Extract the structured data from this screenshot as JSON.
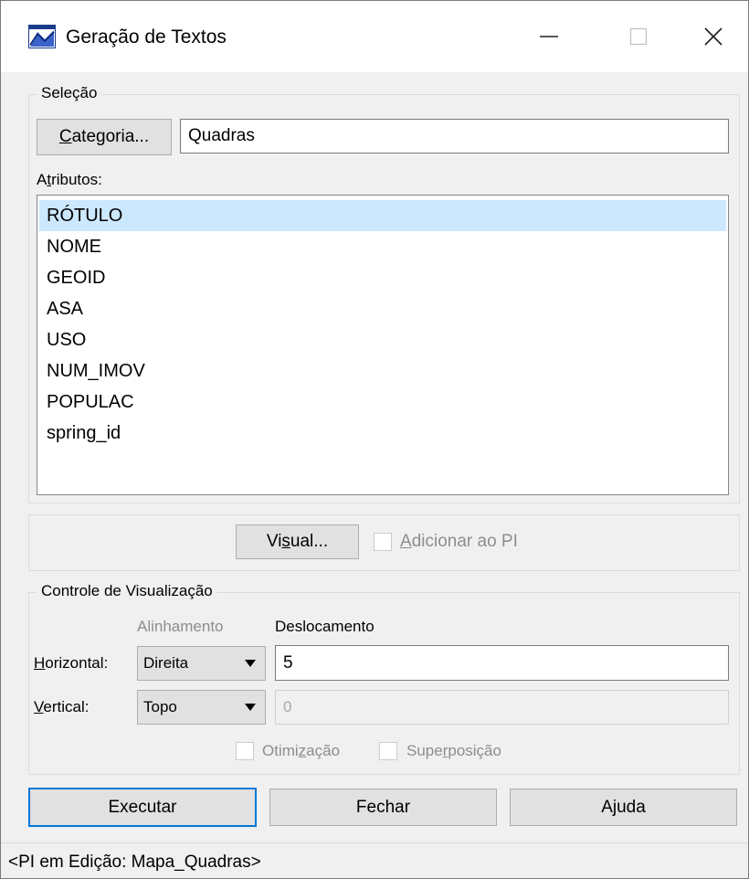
{
  "window": {
    "title": "Geração de Textos"
  },
  "selecao": {
    "legend": "Seleção",
    "categoria_button": {
      "pre": "",
      "access": "C",
      "post": "ategoria..."
    },
    "categoria_value": "Quadras",
    "atributos_label": {
      "pre": "A",
      "access": "t",
      "post": "ributos:"
    },
    "atributos": [
      {
        "label": "RÓTULO",
        "selected": true
      },
      {
        "label": "NOME",
        "selected": false
      },
      {
        "label": "GEOID",
        "selected": false
      },
      {
        "label": "ASA",
        "selected": false
      },
      {
        "label": "USO",
        "selected": false
      },
      {
        "label": "NUM_IMOV",
        "selected": false
      },
      {
        "label": "POPULAC",
        "selected": false
      },
      {
        "label": "spring_id",
        "selected": false
      }
    ]
  },
  "visual_button": {
    "pre": "Vi",
    "access": "s",
    "post": "ual..."
  },
  "adicionar_pi": {
    "pre": "",
    "access": "A",
    "post": "dicionar ao PI",
    "checked": false,
    "enabled": false
  },
  "controle": {
    "legend": "Controle de Visualização",
    "alinhamento_header": "Alinhamento",
    "deslocamento_header": "Deslocamento",
    "horizontal_label": {
      "pre": "",
      "access": "H",
      "post": "orizontal:"
    },
    "horizontal_align": "Direita",
    "horizontal_offset": "5",
    "vertical_label": {
      "pre": "",
      "access": "V",
      "post": "ertical:"
    },
    "vertical_align": "Topo",
    "vertical_offset": "0",
    "otimizacao": {
      "pre": "Otimi",
      "access": "z",
      "post": "ação",
      "checked": false,
      "enabled": false
    },
    "superposicao": {
      "pre": "Supe",
      "access": "r",
      "post": "posição",
      "checked": false,
      "enabled": false
    }
  },
  "buttons": {
    "executar": "Executar",
    "fechar": "Fechar",
    "ajuda": "Ajuda"
  },
  "status": "<PI em Edição: Mapa_Quadras>"
}
